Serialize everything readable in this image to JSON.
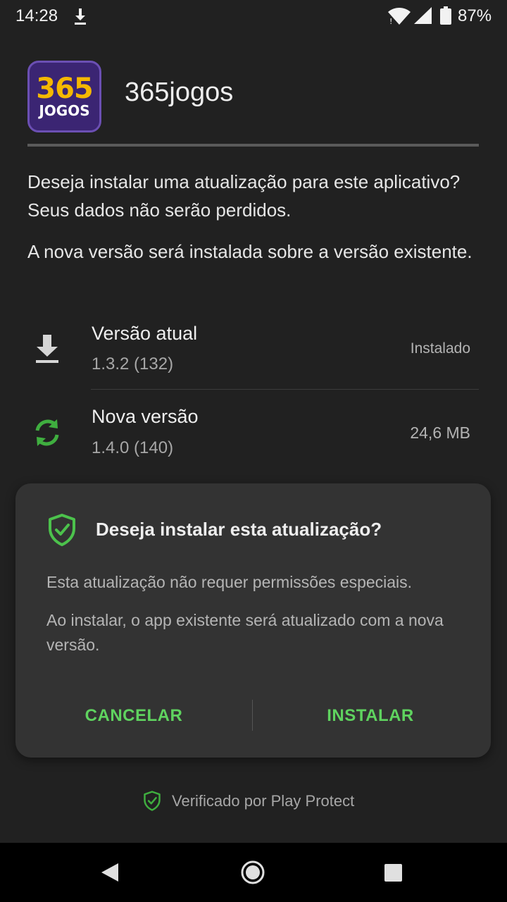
{
  "status_bar": {
    "time": "14:28",
    "battery_percent": "87%",
    "icons": [
      "download-icon",
      "wifi-icon",
      "signal-icon",
      "battery-icon"
    ]
  },
  "app": {
    "name": "365jogos",
    "logo_text_top": "365",
    "logo_text_bottom": "JOGOS"
  },
  "message": {
    "line1": "Deseja instalar uma atualização para este aplicativo? Seus dados não serão perdidos.",
    "line2": "A nova versão será instalada sobre a versão existente."
  },
  "versions": {
    "current": {
      "title": "Versão atual",
      "version": "1.3.2 (132)",
      "status": "Instalado",
      "icon": "download-icon"
    },
    "new": {
      "title": "Nova versão",
      "version": "1.4.0 (140)",
      "size": "24,6 MB",
      "icon": "refresh-icon"
    }
  },
  "dialog": {
    "title": "Deseja instalar esta atualização?",
    "text1": "Esta atualização não requer permissões especiais.",
    "text2": "Ao instalar, o app existente será atualizado com a nova versão.",
    "cancel_label": "CANCELAR",
    "install_label": "INSTALAR",
    "icon": "shield-check-icon"
  },
  "footer": {
    "verified_text": "Verificado por Play Protect",
    "icon": "shield-check-icon"
  },
  "colors": {
    "background": "#212121",
    "dialog": "#333333",
    "accent_green": "#5fd35f",
    "nav_bar": "#000000"
  },
  "nav_bar": {
    "icons": [
      "back-icon",
      "home-icon",
      "recents-icon"
    ]
  }
}
